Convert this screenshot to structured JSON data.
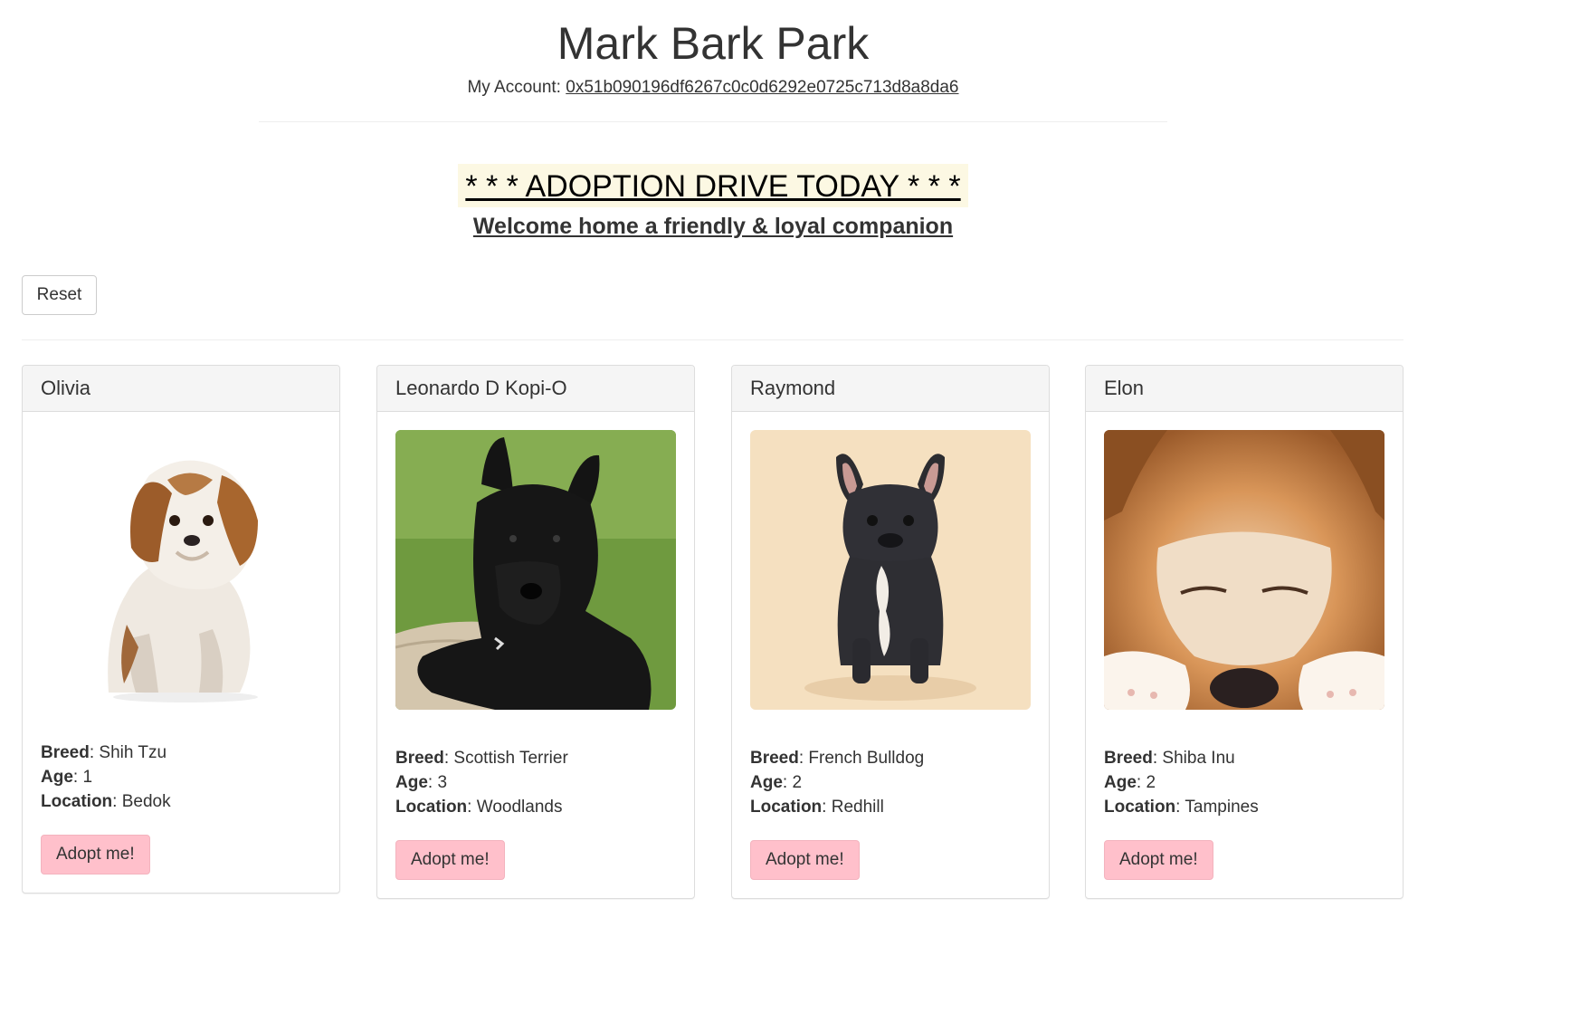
{
  "header": {
    "title": "Mark Bark Park",
    "account_label": "My Account: ",
    "account_address": "0x51b090196df6267c0c0d6292e0725c713d8a8da6"
  },
  "banner": {
    "headline": "* * * ADOPTION DRIVE TODAY * * *",
    "subheadline": "Welcome home a friendly & loyal companion"
  },
  "controls": {
    "reset_label": "Reset"
  },
  "labels": {
    "breed": "Breed",
    "age": "Age",
    "location": "Location",
    "adopt_button": "Adopt me!"
  },
  "pets": [
    {
      "name": "Olivia",
      "breed": "Shih Tzu",
      "age": "1",
      "location": "Bedok"
    },
    {
      "name": "Leonardo D Kopi-O",
      "breed": "Scottish Terrier",
      "age": "3",
      "location": "Woodlands"
    },
    {
      "name": "Raymond",
      "breed": "French Bulldog",
      "age": "2",
      "location": "Redhill"
    },
    {
      "name": "Elon",
      "breed": "Shiba Inu",
      "age": "2",
      "location": "Tampines"
    }
  ]
}
